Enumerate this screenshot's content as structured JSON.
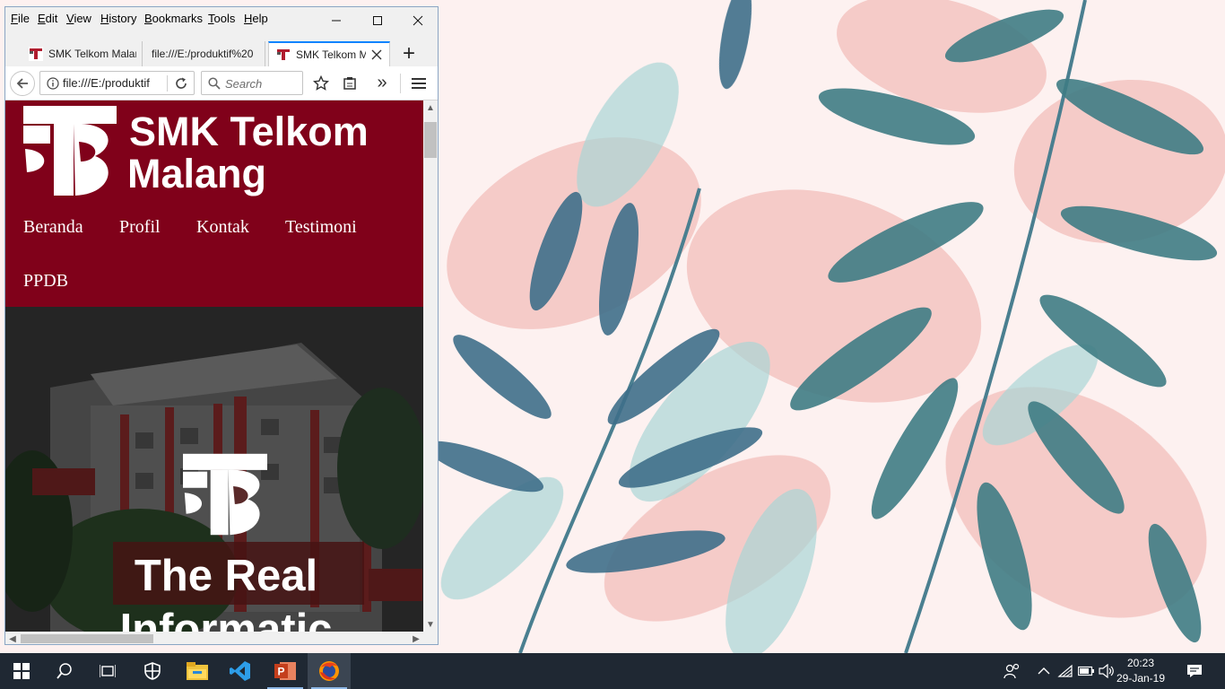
{
  "browser": {
    "menu": [
      "File",
      "Edit",
      "View",
      "History",
      "Bookmarks",
      "Tools",
      "Help"
    ],
    "tabs": [
      {
        "title": "SMK Telkom Malang"
      },
      {
        "title": "file:///E:/produktif%20"
      },
      {
        "title": "SMK Telkom Malang"
      }
    ],
    "new_tab_label": "+",
    "url": "file:///E:/produktif",
    "search_placeholder": "Search",
    "overflow_label": "»"
  },
  "site": {
    "name_line1": "SMK Telkom",
    "name_line2": "Malang",
    "nav": [
      "Beranda",
      "Profil",
      "Kontak",
      "Testimoni",
      "PPDB"
    ],
    "hero_line1": "The Real",
    "hero_line2": "Informatic",
    "brand_color": "#80011a"
  },
  "taskbar": {
    "apps": [
      "start-icon",
      "search-icon",
      "task-view-icon",
      "shield-icon",
      "file-explorer-icon",
      "vscode-icon",
      "powerpoint-icon",
      "firefox-icon"
    ],
    "time": "20:23",
    "date": "29-Jan-19"
  }
}
